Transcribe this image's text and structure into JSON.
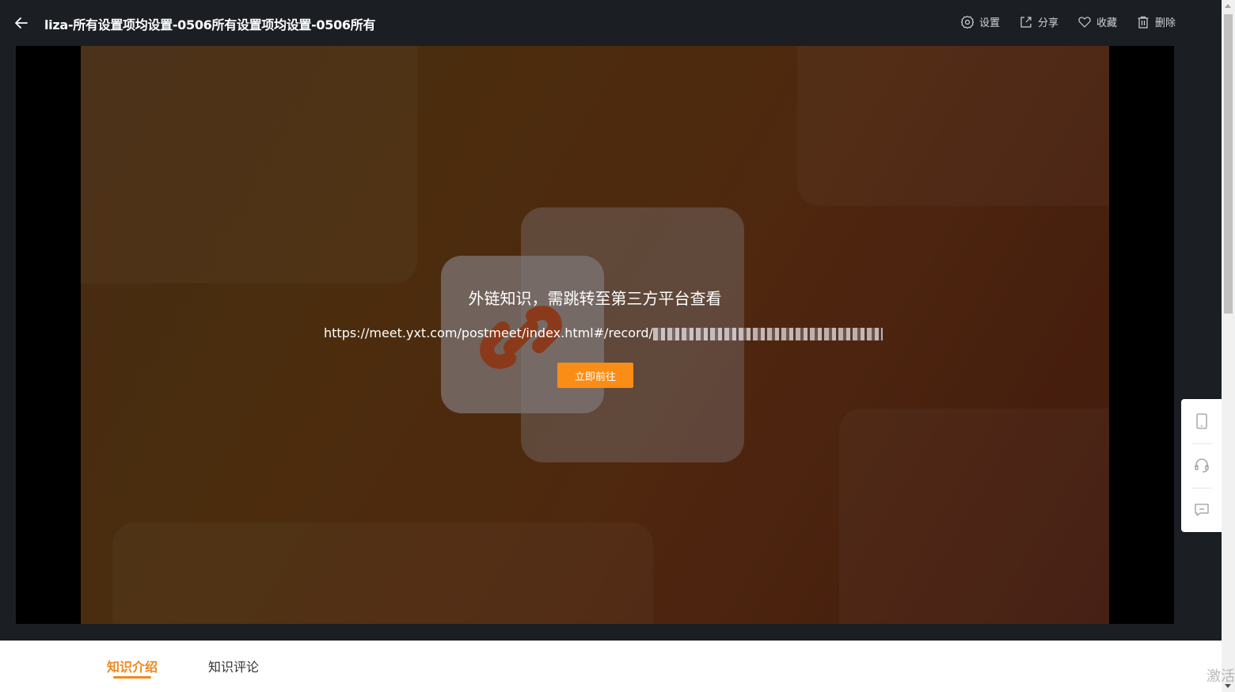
{
  "header": {
    "title": "liza-所有设置项均设置-0506所有设置项均设置-0506所有",
    "actions": [
      {
        "label": "设置",
        "icon": "gear-icon"
      },
      {
        "label": "分享",
        "icon": "share-icon"
      },
      {
        "label": "收藏",
        "icon": "heart-icon"
      },
      {
        "label": "删除",
        "icon": "trash-icon"
      }
    ]
  },
  "player": {
    "message": "外链知识，需跳转至第三方平台查看",
    "url": "https://meet.yxt.com/postmeet/index.html#/record/",
    "go_button": "立即前往"
  },
  "tabs": [
    {
      "label": "知识介绍",
      "active": true
    },
    {
      "label": "知识评论",
      "active": false
    }
  ],
  "side_tools": [
    {
      "icon": "mobile-icon"
    },
    {
      "icon": "headset-icon"
    },
    {
      "icon": "comment-icon"
    }
  ],
  "watermark": "激活",
  "colors": {
    "accent": "#f98d15",
    "header_bg": "#1b1e23",
    "tab_active": "#f0881b"
  }
}
